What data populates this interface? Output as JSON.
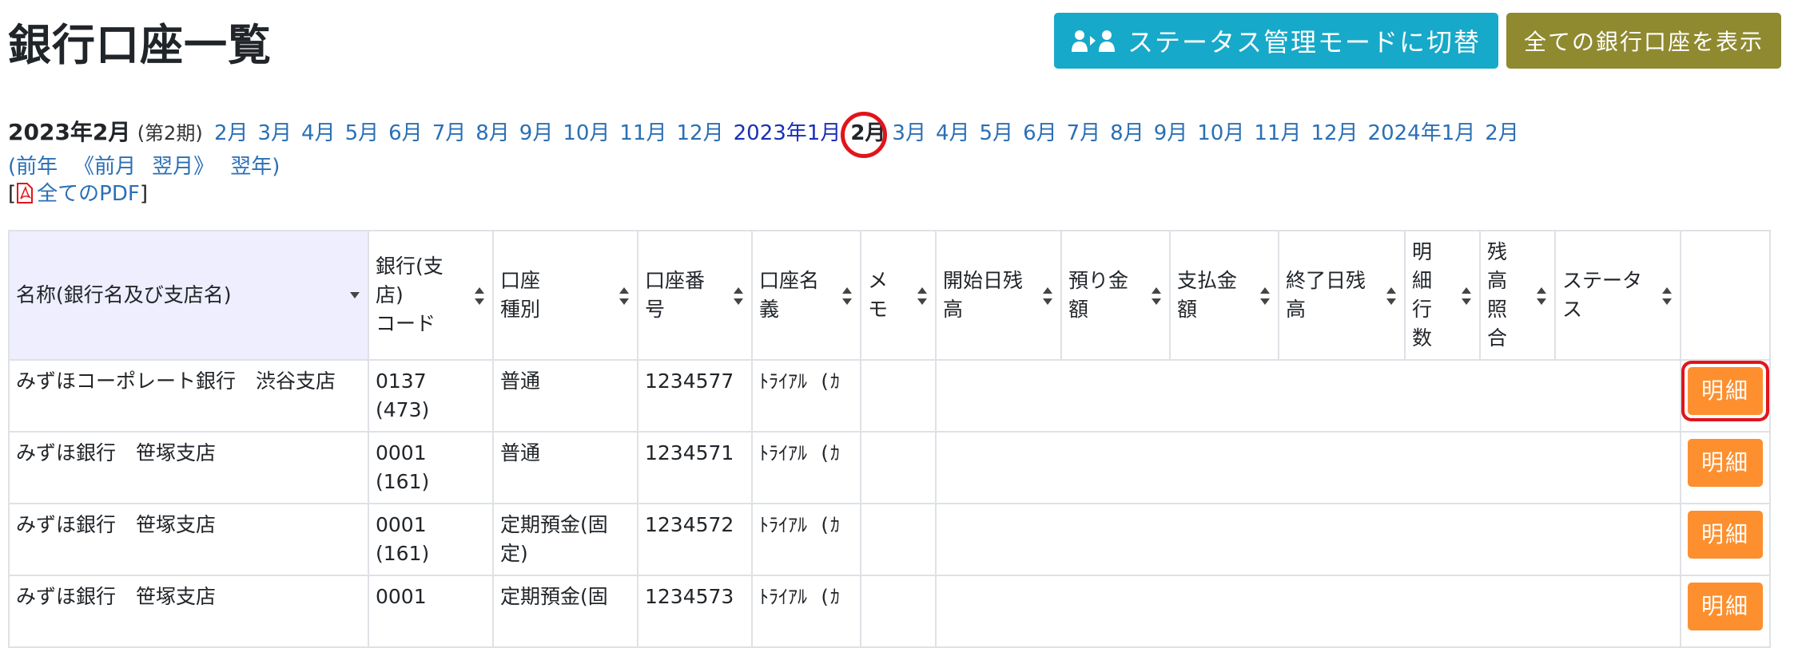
{
  "page": {
    "title": "銀行口座一覧"
  },
  "actions": {
    "status_mode": "ステータス管理モードに切替",
    "show_all": "全ての銀行口座を表示"
  },
  "period": {
    "current": "2023年2月",
    "term": "(第2期)",
    "months": [
      "2月",
      "3月",
      "4月",
      "5月",
      "6月",
      "7月",
      "8月",
      "9月",
      "10月",
      "11月",
      "12月"
    ],
    "year2023": "2023年1月",
    "selected": "2月",
    "months2": [
      "3月",
      "4月",
      "5月",
      "6月",
      "7月",
      "8月",
      "9月",
      "10月",
      "11月",
      "12月"
    ],
    "year2024": "2024年1月",
    "last": "2月"
  },
  "nav": {
    "prev_year": "(前年",
    "prev_month": "《前月",
    "next_month": "翌月》",
    "next_year": "翌年)"
  },
  "pdf": {
    "label": "全てのPDF",
    "open": "[",
    "close": "]"
  },
  "table": {
    "headers": [
      "名称(銀行名及び支店名)",
      "銀行(支店)コード",
      "口座種別",
      "口座番号",
      "口座名義",
      "メモ",
      "開始日残高",
      "預り金額",
      "支払金額",
      "終了日残高",
      "明細行数",
      "残高照合",
      "ステータス",
      ""
    ],
    "header_lines": [
      [
        "名称(銀行名及び支店名)"
      ],
      [
        "銀行(支",
        "店)",
        "コード"
      ],
      [
        "口座",
        "種別"
      ],
      [
        "口座番",
        "号"
      ],
      [
        "口座名",
        "義"
      ],
      [
        "メ",
        "モ"
      ],
      [
        "開始日残",
        "高"
      ],
      [
        "預り金",
        "額"
      ],
      [
        "支払金",
        "額"
      ],
      [
        "終了日残",
        "高"
      ],
      [
        "明",
        "細",
        "行",
        "数"
      ],
      [
        "残",
        "高",
        "照",
        "合"
      ],
      [
        "ステータ",
        "ス"
      ]
    ],
    "rows": [
      {
        "name": "みずほコーポレート銀行　渋谷支店",
        "code1": "0137",
        "code2": "(473)",
        "type": "普通",
        "number": "1234577",
        "holder": "ﾄﾗｲｱﾙ (ｶ",
        "detail": "明細"
      },
      {
        "name": "みずほ銀行　笹塚支店",
        "code1": "0001",
        "code2": "(161)",
        "type": "普通",
        "number": "1234571",
        "holder": "ﾄﾗｲｱﾙ (ｶ",
        "detail": "明細"
      },
      {
        "name": "みずほ銀行　笹塚支店",
        "code1": "0001",
        "code2": "(161)",
        "type": "定期預金(固定)",
        "number": "1234572",
        "holder": "ﾄﾗｲｱﾙ (ｶ",
        "detail": "明細"
      },
      {
        "name": "みずほ銀行　笹塚支店",
        "code1": "0001",
        "code2": "",
        "type": "定期預金(固",
        "number": "1234573",
        "holder": "ﾄﾗｲｱﾙ (ｶ",
        "detail": "明細"
      }
    ]
  },
  "colors": {
    "info": "#17a9c9",
    "olive": "#8f8930",
    "orange": "#fd8f2e",
    "link": "#2a6fb5",
    "highlight": "#e2141b"
  }
}
